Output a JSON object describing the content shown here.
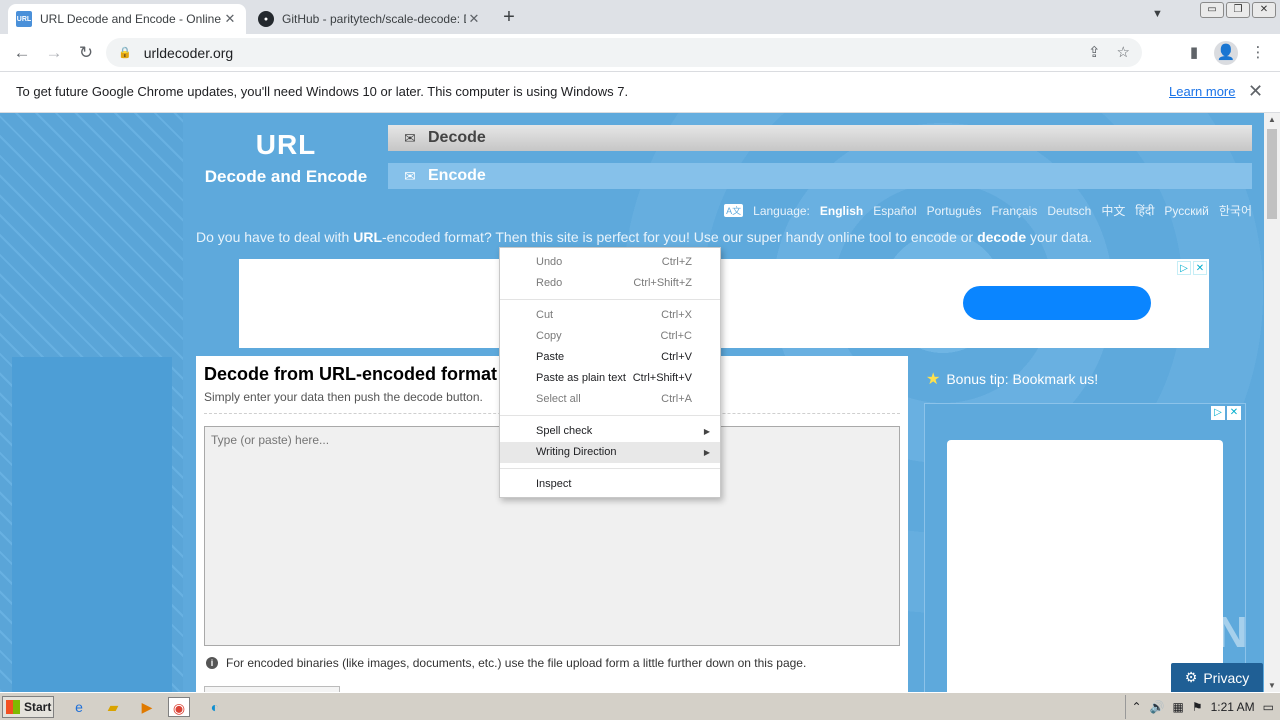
{
  "browser": {
    "tabs": [
      {
        "title": "URL Decode and Encode - Online",
        "active": true,
        "favicon": "URL"
      },
      {
        "title": "GitHub - paritytech/scale-decode: De",
        "active": false,
        "favicon": "github-icon"
      }
    ],
    "address": "urldecoder.org",
    "window_buttons": [
      "▭",
      "❐",
      "✕"
    ]
  },
  "infobar": {
    "message": "To get future Google Chrome updates, you'll need Windows 10 or later. This computer is using Windows 7.",
    "link": "Learn more"
  },
  "site": {
    "logo_line1": "URL",
    "logo_line2": "Decode and Encode",
    "nav": {
      "decode": "Decode",
      "encode": "Encode"
    },
    "language_label": "Language:",
    "languages": [
      "English",
      "Español",
      "Português",
      "Français",
      "Deutsch",
      "中文",
      "हिंदी",
      "Русский",
      "한국어"
    ],
    "tagline": {
      "t1": "Do you have to deal with ",
      "b1": "URL",
      "t2": "-encoded format? Then this site is perfect for you! Use our super handy online tool to encode or ",
      "b2": "decode",
      "t3": " your data."
    },
    "panel": {
      "heading": "Decode from URL-encoded format",
      "subheading": "Simply enter your data then push the decode button.",
      "placeholder": "Type (or paste) here...",
      "note": "For encoded binaries (like images, documents, etc.) use the file upload form a little further down on this page."
    },
    "bonus_tip": "Bonus tip: Bookmark us!",
    "privacy": "Privacy",
    "watermark": "ANY RUN"
  },
  "context_menu": [
    {
      "label": "Undo",
      "shortcut": "Ctrl+Z",
      "disabled": true
    },
    {
      "label": "Redo",
      "shortcut": "Ctrl+Shift+Z",
      "disabled": true
    },
    {
      "sep": true
    },
    {
      "label": "Cut",
      "shortcut": "Ctrl+X",
      "disabled": true
    },
    {
      "label": "Copy",
      "shortcut": "Ctrl+C",
      "disabled": true
    },
    {
      "label": "Paste",
      "shortcut": "Ctrl+V",
      "disabled": false
    },
    {
      "label": "Paste as plain text",
      "shortcut": "Ctrl+Shift+V",
      "disabled": false
    },
    {
      "label": "Select all",
      "shortcut": "Ctrl+A",
      "disabled": true
    },
    {
      "sep": true
    },
    {
      "label": "Spell check",
      "submenu": true
    },
    {
      "label": "Writing Direction",
      "submenu": true,
      "highlighted": true
    },
    {
      "sep": true
    },
    {
      "label": "Inspect"
    }
  ],
  "taskbar": {
    "start": "Start",
    "clock": "1:21 AM"
  }
}
